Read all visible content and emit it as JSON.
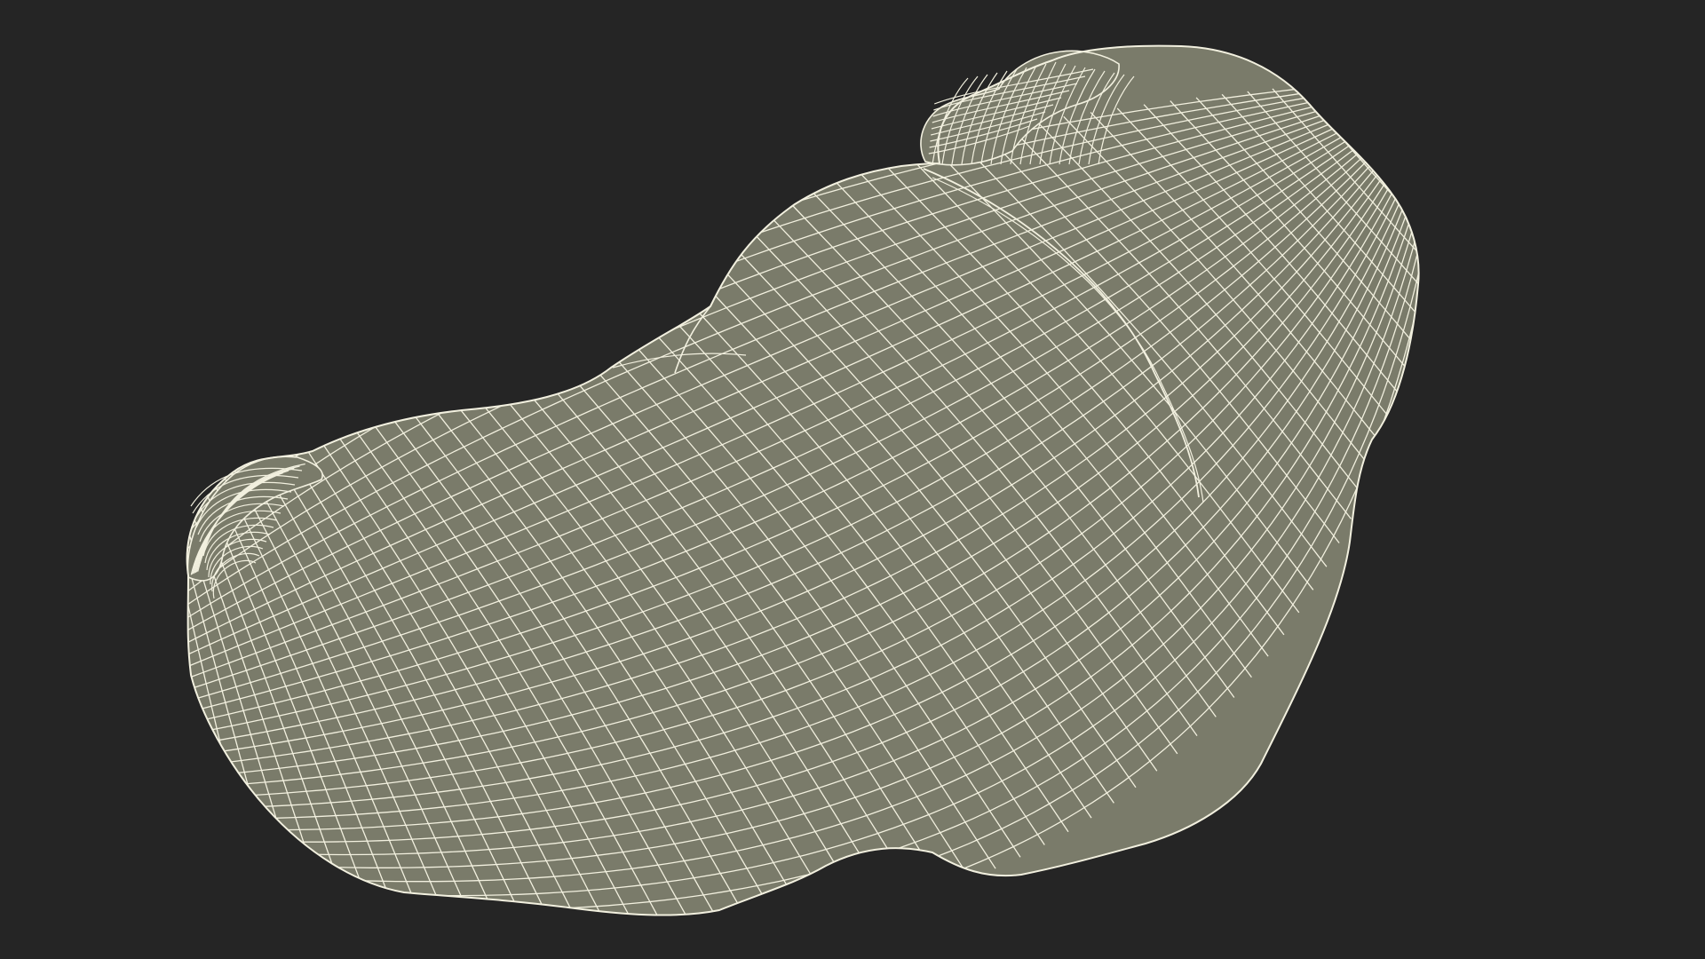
{
  "viewport": {
    "background_color": "#252525"
  },
  "model": {
    "name_hint": "",
    "render_mode": "wireframe",
    "surface_color": "#7a7b6a",
    "wire_color": "#f2f0df"
  }
}
